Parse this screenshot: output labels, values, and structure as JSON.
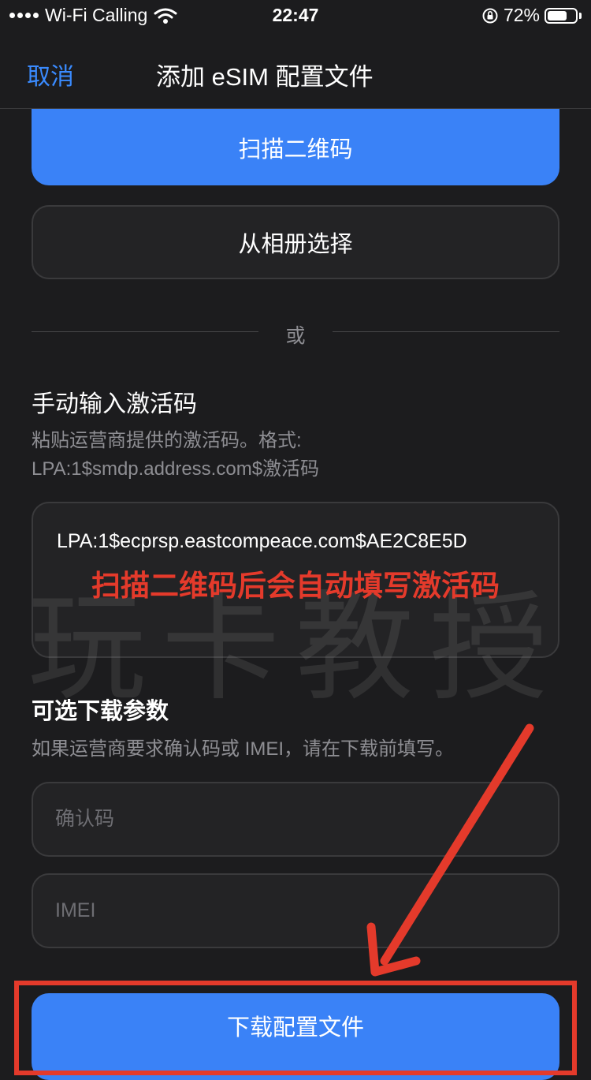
{
  "status_bar": {
    "carrier": "Wi-Fi Calling",
    "time": "22:47",
    "battery_percent": "72%",
    "battery_level": 0.72
  },
  "nav": {
    "cancel_label": "取消",
    "title": "添加 eSIM 配置文件"
  },
  "actions": {
    "scan_qr_label": "扫描二维码",
    "choose_photo_label": "从相册选择",
    "or_label": "或"
  },
  "manual": {
    "title": "手动输入激活码",
    "hint_line1": "粘贴运营商提供的激活码。格式:",
    "hint_line2": "LPA:1$smdp.address.com$激活码",
    "code_value": "LPA:1$ecprsp.eastcompeace.com$AE2C8E5D"
  },
  "optional": {
    "title": "可选下载参数",
    "hint": "如果运营商要求确认码或 IMEI，请在下载前填写。",
    "confirmation_placeholder": "确认码",
    "imei_placeholder": "IMEI"
  },
  "download_label": "下载配置文件",
  "overlay": {
    "watermark": "玩卡教授",
    "annotation": "扫描二维码后会自动填写激活码"
  },
  "colors": {
    "accent": "#3a82f7",
    "annotation_red": "#e43a2b",
    "background": "#1c1c1e"
  }
}
